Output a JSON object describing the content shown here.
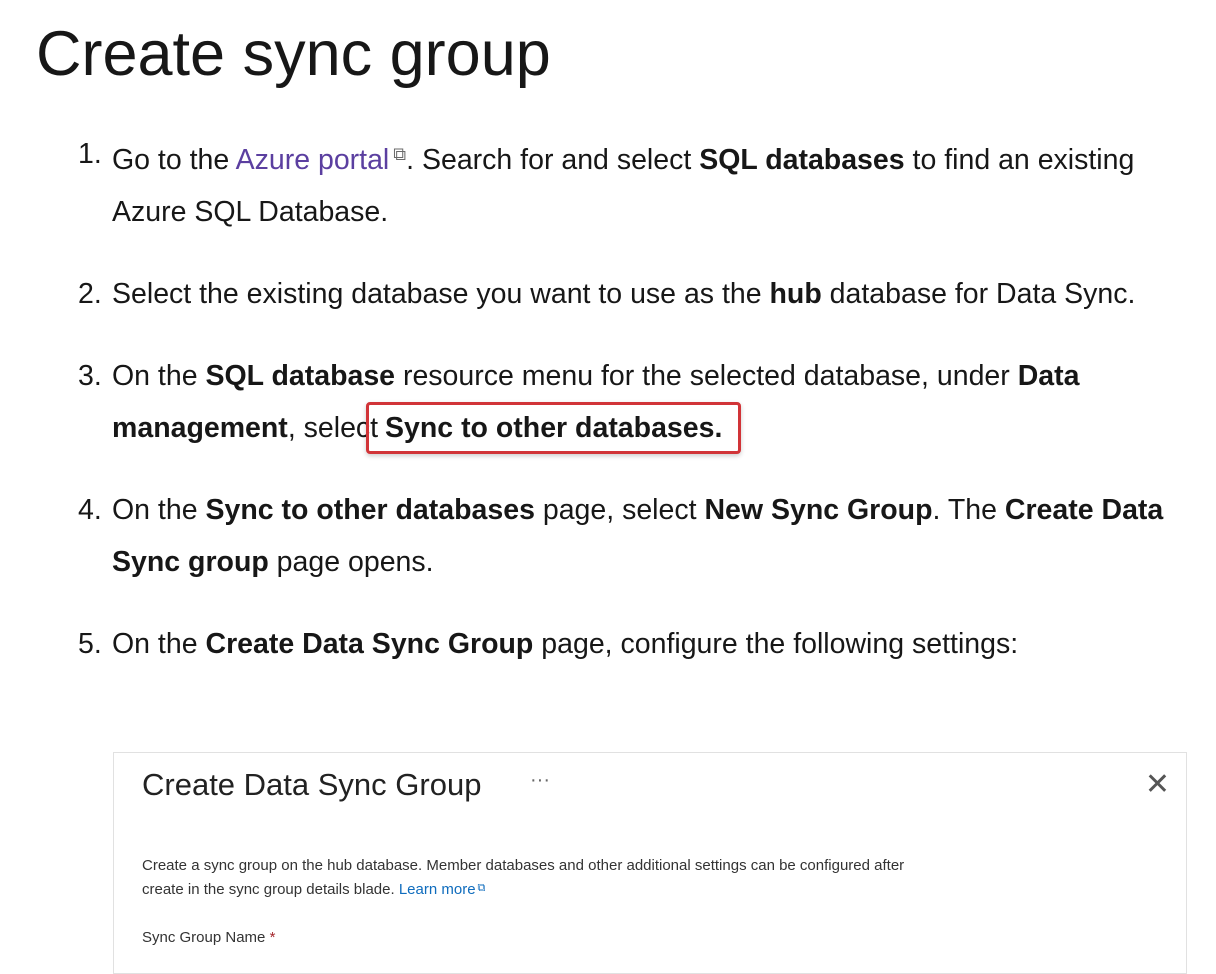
{
  "page": {
    "title": "Create sync group"
  },
  "steps": [
    {
      "num": "1.",
      "t1": "Go to the ",
      "link": "Azure portal",
      "t2": ". Search for and select ",
      "b1": "SQL databases",
      "t3": " to find an existing Azure SQL Database."
    },
    {
      "num": "2.",
      "t1": "Select the existing database you want to use as the ",
      "b1": "hub",
      "t2": " database for Data Sync."
    },
    {
      "num": "3.",
      "t1": "On the ",
      "b1": "SQL database",
      "t2": " resource menu for the selected database, under ",
      "b2": "Data management",
      "t3": ", select ",
      "b3": "Sync to other databases."
    },
    {
      "num": "4.",
      "t1": "On the ",
      "b1": "Sync to other databases",
      "t2": " page, select ",
      "b2": "New Sync Group",
      "t3": ". The ",
      "b3": "Create Data Sync group",
      "t4": " page opens."
    },
    {
      "num": "5.",
      "t1": "On the ",
      "b1": "Create Data Sync Group",
      "t2": " page, configure the following settings:"
    }
  ],
  "panel": {
    "title": "Create Data Sync Group",
    "more": "···",
    "close": "✕",
    "desc": "Create a sync group on the hub database. Member databases and other additional settings can be configured after create in the sync group details blade. ",
    "learn_more": "Learn more",
    "field_label": "Sync Group Name",
    "required_mark": "*"
  },
  "icons": {
    "external_link": "external-link-icon"
  },
  "colors": {
    "link": "#5b3fa0",
    "highlight_border": "#d13438",
    "panel_link": "#0f6cbd"
  }
}
